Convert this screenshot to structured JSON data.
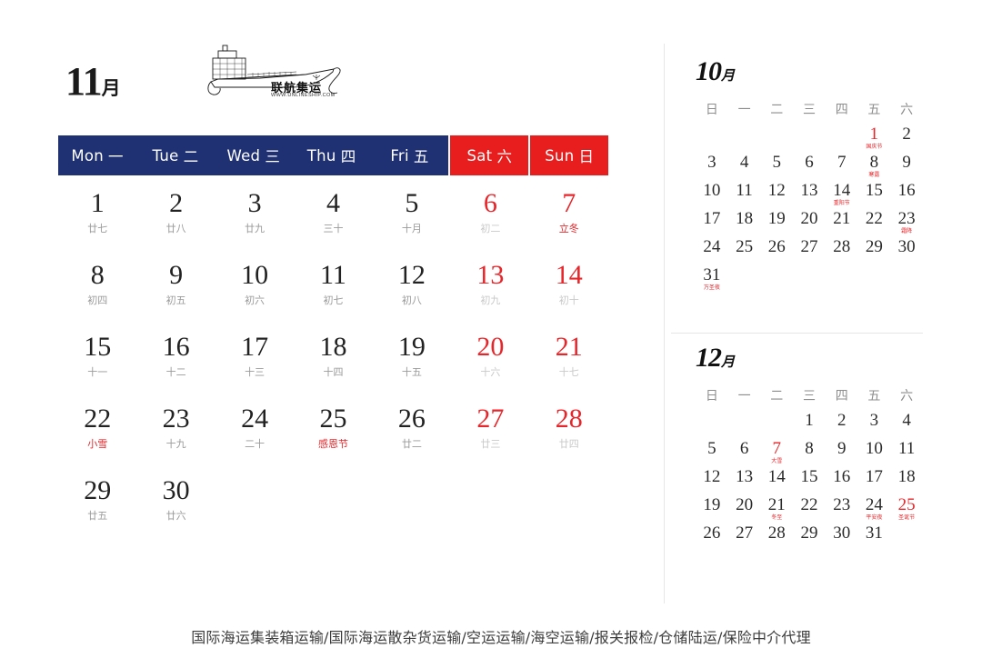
{
  "colors": {
    "header_weekday_bg": "#1F3173",
    "header_weekend_bg": "#E81D1D",
    "accent_red": "#E6262A",
    "lunar_gray": "#9A9A9A",
    "divider": "#E6E6E6"
  },
  "main_month": {
    "number": "11",
    "suffix": "月",
    "logo": {
      "icon": "cargo-ship-icon",
      "company_cn": "联航集运",
      "url": "WWW.UNLINESHIP.COM"
    },
    "dow": [
      {
        "en": "Mon",
        "cn": "一",
        "weekend": false
      },
      {
        "en": "Tue",
        "cn": "二",
        "weekend": false
      },
      {
        "en": "Wed",
        "cn": "三",
        "weekend": false
      },
      {
        "en": "Thu",
        "cn": "四",
        "weekend": false
      },
      {
        "en": "Fri",
        "cn": "五",
        "weekend": false
      },
      {
        "en": "Sat",
        "cn": "六",
        "weekend": true
      },
      {
        "en": "Sun",
        "cn": "日",
        "weekend": true
      }
    ],
    "days": [
      {
        "num": "1",
        "lunar": "廿七",
        "red": false,
        "festival": false
      },
      {
        "num": "2",
        "lunar": "廿八",
        "red": false,
        "festival": false
      },
      {
        "num": "3",
        "lunar": "廿九",
        "red": false,
        "festival": false
      },
      {
        "num": "4",
        "lunar": "三十",
        "red": false,
        "festival": false
      },
      {
        "num": "5",
        "lunar": "十月",
        "red": false,
        "festival": false
      },
      {
        "num": "6",
        "lunar": "初二",
        "red": true,
        "festival": false
      },
      {
        "num": "7",
        "lunar": "立冬",
        "red": true,
        "festival": true
      },
      {
        "num": "8",
        "lunar": "初四",
        "red": false,
        "festival": false
      },
      {
        "num": "9",
        "lunar": "初五",
        "red": false,
        "festival": false
      },
      {
        "num": "10",
        "lunar": "初六",
        "red": false,
        "festival": false
      },
      {
        "num": "11",
        "lunar": "初七",
        "red": false,
        "festival": false
      },
      {
        "num": "12",
        "lunar": "初八",
        "red": false,
        "festival": false
      },
      {
        "num": "13",
        "lunar": "初九",
        "red": true,
        "festival": false
      },
      {
        "num": "14",
        "lunar": "初十",
        "red": true,
        "festival": false
      },
      {
        "num": "15",
        "lunar": "十一",
        "red": false,
        "festival": false
      },
      {
        "num": "16",
        "lunar": "十二",
        "red": false,
        "festival": false
      },
      {
        "num": "17",
        "lunar": "十三",
        "red": false,
        "festival": false
      },
      {
        "num": "18",
        "lunar": "十四",
        "red": false,
        "festival": false
      },
      {
        "num": "19",
        "lunar": "十五",
        "red": false,
        "festival": false
      },
      {
        "num": "20",
        "lunar": "十六",
        "red": true,
        "festival": false
      },
      {
        "num": "21",
        "lunar": "十七",
        "red": true,
        "festival": false
      },
      {
        "num": "22",
        "lunar": "小雪",
        "red": false,
        "festival": true
      },
      {
        "num": "23",
        "lunar": "十九",
        "red": false,
        "festival": false
      },
      {
        "num": "24",
        "lunar": "二十",
        "red": false,
        "festival": false
      },
      {
        "num": "25",
        "lunar": "感恩节",
        "red": false,
        "festival": true
      },
      {
        "num": "26",
        "lunar": "廿二",
        "red": false,
        "festival": false
      },
      {
        "num": "27",
        "lunar": "廿三",
        "red": true,
        "festival": false
      },
      {
        "num": "28",
        "lunar": "廿四",
        "red": true,
        "festival": false
      },
      {
        "num": "29",
        "lunar": "廿五",
        "red": false,
        "festival": false
      },
      {
        "num": "30",
        "lunar": "廿六",
        "red": false,
        "festival": false
      },
      {
        "num": "",
        "lunar": "",
        "red": false,
        "festival": false,
        "blank": true
      },
      {
        "num": "",
        "lunar": "",
        "red": false,
        "festival": false,
        "blank": true
      },
      {
        "num": "",
        "lunar": "",
        "red": false,
        "festival": false,
        "blank": true
      },
      {
        "num": "",
        "lunar": "",
        "red": false,
        "festival": false,
        "blank": true
      },
      {
        "num": "",
        "lunar": "",
        "red": false,
        "festival": false,
        "blank": true
      }
    ]
  },
  "mini_months": [
    {
      "number": "10",
      "suffix": "月",
      "dow": [
        "日",
        "一",
        "二",
        "三",
        "四",
        "五",
        "六"
      ],
      "days": [
        {
          "num": "",
          "blank": true
        },
        {
          "num": "",
          "blank": true
        },
        {
          "num": "",
          "blank": true
        },
        {
          "num": "",
          "blank": true
        },
        {
          "num": "",
          "blank": true
        },
        {
          "num": "1",
          "label": "国庆节",
          "red": true
        },
        {
          "num": "2"
        },
        {
          "num": "3"
        },
        {
          "num": "4"
        },
        {
          "num": "5"
        },
        {
          "num": "6"
        },
        {
          "num": "7"
        },
        {
          "num": "8",
          "label": "寒露"
        },
        {
          "num": "9"
        },
        {
          "num": "10"
        },
        {
          "num": "11"
        },
        {
          "num": "12"
        },
        {
          "num": "13"
        },
        {
          "num": "14",
          "label": "重阳节"
        },
        {
          "num": "15"
        },
        {
          "num": "16"
        },
        {
          "num": "17"
        },
        {
          "num": "18"
        },
        {
          "num": "19"
        },
        {
          "num": "20"
        },
        {
          "num": "21"
        },
        {
          "num": "22"
        },
        {
          "num": "23",
          "label": "霜降"
        },
        {
          "num": "24"
        },
        {
          "num": "25"
        },
        {
          "num": "26"
        },
        {
          "num": "27"
        },
        {
          "num": "28"
        },
        {
          "num": "29"
        },
        {
          "num": "30"
        },
        {
          "num": "31",
          "label": "万圣夜"
        },
        {
          "num": "",
          "blank": true
        },
        {
          "num": "",
          "blank": true
        },
        {
          "num": "",
          "blank": true
        },
        {
          "num": "",
          "blank": true
        },
        {
          "num": "",
          "blank": true
        },
        {
          "num": "",
          "blank": true
        }
      ]
    },
    {
      "number": "12",
      "suffix": "月",
      "dow": [
        "日",
        "一",
        "二",
        "三",
        "四",
        "五",
        "六"
      ],
      "days": [
        {
          "num": "",
          "blank": true
        },
        {
          "num": "",
          "blank": true
        },
        {
          "num": "",
          "blank": true
        },
        {
          "num": "1"
        },
        {
          "num": "2"
        },
        {
          "num": "3"
        },
        {
          "num": "4"
        },
        {
          "num": "5"
        },
        {
          "num": "6"
        },
        {
          "num": "7",
          "label": "大雪",
          "red": true
        },
        {
          "num": "8"
        },
        {
          "num": "9"
        },
        {
          "num": "10"
        },
        {
          "num": "11"
        },
        {
          "num": "12"
        },
        {
          "num": "13"
        },
        {
          "num": "14"
        },
        {
          "num": "15"
        },
        {
          "num": "16"
        },
        {
          "num": "17"
        },
        {
          "num": "18"
        },
        {
          "num": "19"
        },
        {
          "num": "20"
        },
        {
          "num": "21",
          "label": "冬至"
        },
        {
          "num": "22"
        },
        {
          "num": "23"
        },
        {
          "num": "24",
          "label": "平安夜"
        },
        {
          "num": "25",
          "label": "圣诞节",
          "red": true
        },
        {
          "num": "26"
        },
        {
          "num": "27"
        },
        {
          "num": "28"
        },
        {
          "num": "29"
        },
        {
          "num": "30"
        },
        {
          "num": "31"
        },
        {
          "num": "",
          "blank": true
        }
      ]
    }
  ],
  "footer": {
    "text": "国际海运集装箱运输/国际海运散杂货运输/空运运输/海空运输/报关报检/仓储陆运/保险中介代理"
  }
}
